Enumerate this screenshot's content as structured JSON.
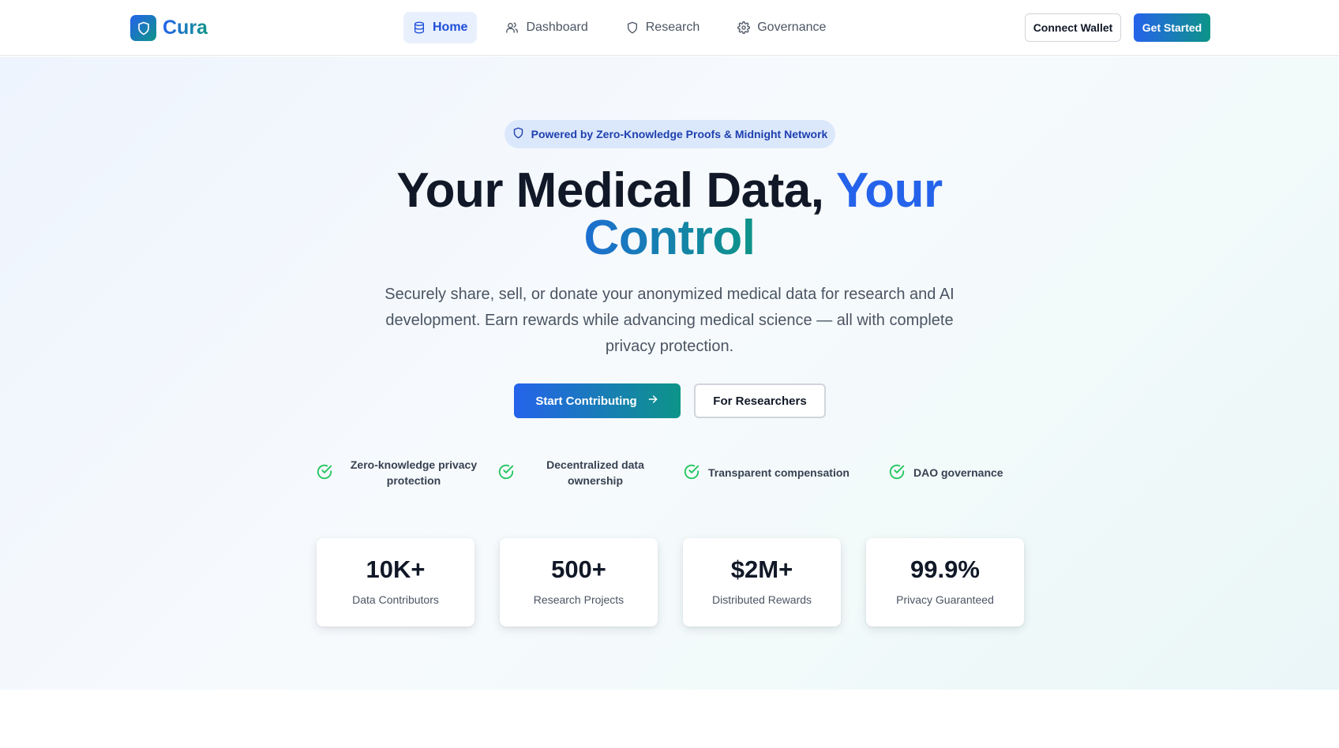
{
  "brand": {
    "name": "Cura",
    "icon": "shield-icon"
  },
  "nav": {
    "items": [
      {
        "label": "Home",
        "icon": "database-icon",
        "active": true
      },
      {
        "label": "Dashboard",
        "icon": "users-icon",
        "active": false
      },
      {
        "label": "Research",
        "icon": "shield-icon",
        "active": false
      },
      {
        "label": "Governance",
        "icon": "gear-icon",
        "active": false
      }
    ]
  },
  "header_actions": {
    "connect_label": "Connect Wallet",
    "started_label": "Get Started"
  },
  "hero": {
    "badge": "Powered by Zero-Knowledge Proofs & Midnight Network",
    "headline_part1": "Your Medical Data,",
    "headline_part2": "Your",
    "headline_part3": "Control",
    "subtitle": "Securely share, sell, or donate your anonymized medical data for research and AI development. Earn rewards while advancing medical science — all with complete privacy protection.",
    "primary_cta": "Start Contributing",
    "secondary_cta": "For Researchers"
  },
  "features": [
    {
      "label": "Zero-knowledge privacy protection",
      "icon": "check-circle-icon"
    },
    {
      "label": "Decentralized data ownership",
      "icon": "check-circle-icon"
    },
    {
      "label": "Transparent compensation",
      "icon": "check-circle-icon"
    },
    {
      "label": "DAO governance",
      "icon": "check-circle-icon"
    }
  ],
  "stats": [
    {
      "value": "10K+",
      "label": "Data Contributors"
    },
    {
      "value": "500+",
      "label": "Research Projects"
    },
    {
      "value": "$2M+",
      "label": "Distributed Rewards"
    },
    {
      "value": "99.9%",
      "label": "Privacy Guaranteed"
    }
  ],
  "colors": {
    "primary": "#2563eb",
    "secondary": "#0d9488",
    "check": "#22c55e"
  }
}
